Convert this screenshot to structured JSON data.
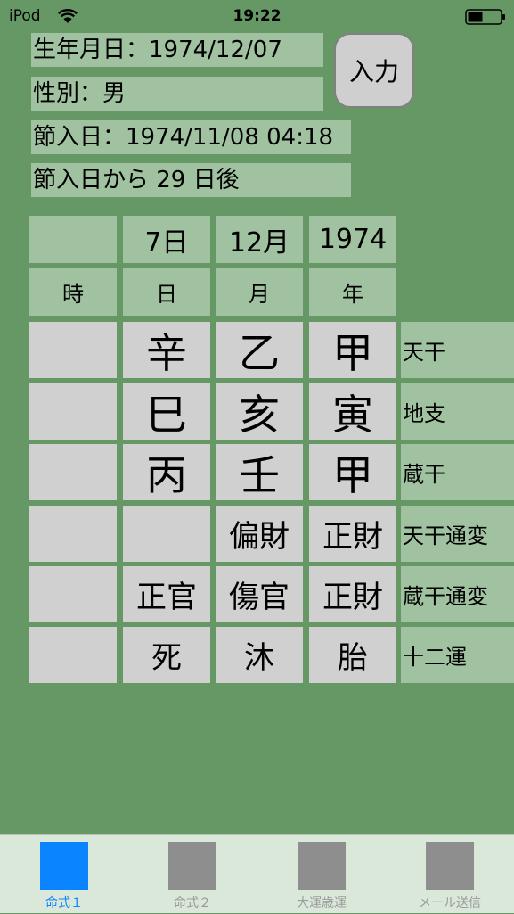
{
  "status_bar": {
    "carrier": "iPod",
    "time": "19:22"
  },
  "info": {
    "birthdate": "生年月日：1974/12/07",
    "gender": "性別：男",
    "setsuiri": "節入日：1974/11/08 04:18",
    "after_setsuiri": "節入日から 29 日後"
  },
  "input_button_label": "入力",
  "table": {
    "header_values": [
      "",
      "7日",
      "12月",
      "1974"
    ],
    "header_labels": [
      "時",
      "日",
      "月",
      "年"
    ],
    "rows": [
      {
        "label": "天干",
        "cells": [
          "",
          "辛",
          "乙",
          "甲"
        ]
      },
      {
        "label": "地支",
        "cells": [
          "",
          "巳",
          "亥",
          "寅"
        ]
      },
      {
        "label": "蔵干",
        "cells": [
          "",
          "丙",
          "壬",
          "甲"
        ]
      },
      {
        "label": "天干通変",
        "cells": [
          "",
          "",
          "偏財",
          "正財"
        ]
      },
      {
        "label": "蔵干通変",
        "cells": [
          "",
          "正官",
          "傷官",
          "正財"
        ]
      },
      {
        "label": "十二運",
        "cells": [
          "",
          "死",
          "沐",
          "胎"
        ]
      }
    ]
  },
  "tabs": [
    {
      "label": "命式１",
      "active": true
    },
    {
      "label": "命式２",
      "active": false
    },
    {
      "label": "大運歳運",
      "active": false
    },
    {
      "label": "メール送信",
      "active": false
    }
  ],
  "colors": {
    "background": "#659865",
    "label_bg": "#a0c2a0",
    "cell_bg": "#d0d0d0",
    "accent": "#0b84ff"
  }
}
